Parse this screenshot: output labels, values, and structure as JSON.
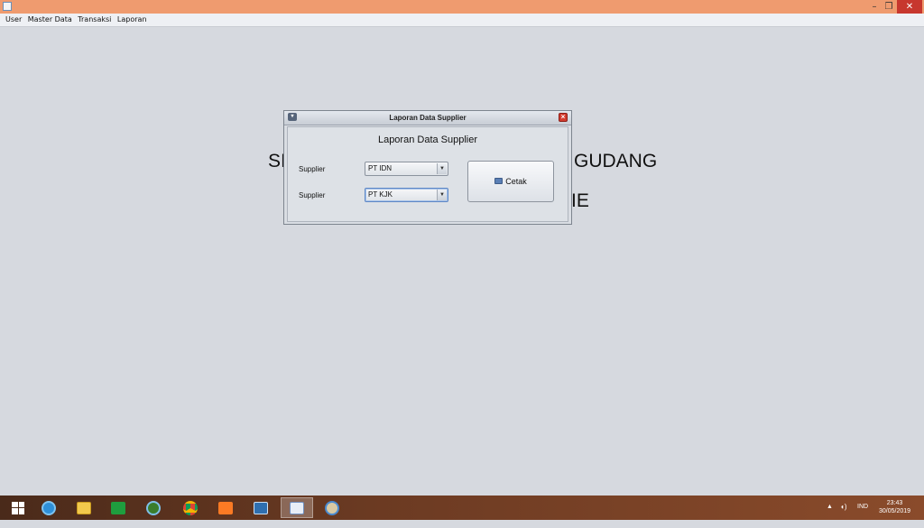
{
  "window": {
    "controls": {
      "minimize": "–",
      "maximize": "❐",
      "close": "✕"
    }
  },
  "menubar": {
    "items": [
      "User",
      "Master Data",
      "Transaksi",
      "Laporan"
    ]
  },
  "background_text": {
    "left": "SI",
    "right": "GUDANG",
    "right2": "IE"
  },
  "dialog": {
    "title": "Laporan Data Supplier",
    "heading": "Laporan Data Supplier",
    "field1_label": "Supplier",
    "field1_value": "PT IDN",
    "field2_label": "Supplier",
    "field2_value": "PT KJK",
    "print_button_label": "Cetak"
  },
  "taskbar": {
    "apps": [
      "start-icon",
      "internet-explorer-icon",
      "file-explorer-icon",
      "store-icon",
      "app-icon",
      "chrome-icon",
      "xampp-icon",
      "virtualbox-icon",
      "java-icon",
      "paint-icon"
    ],
    "language": "IND",
    "time": "23:43",
    "date": "30/05/2019"
  },
  "colors": {
    "titlebar": "#ef9b6f",
    "close": "#c7372e",
    "desktop": "#d6d9df"
  }
}
